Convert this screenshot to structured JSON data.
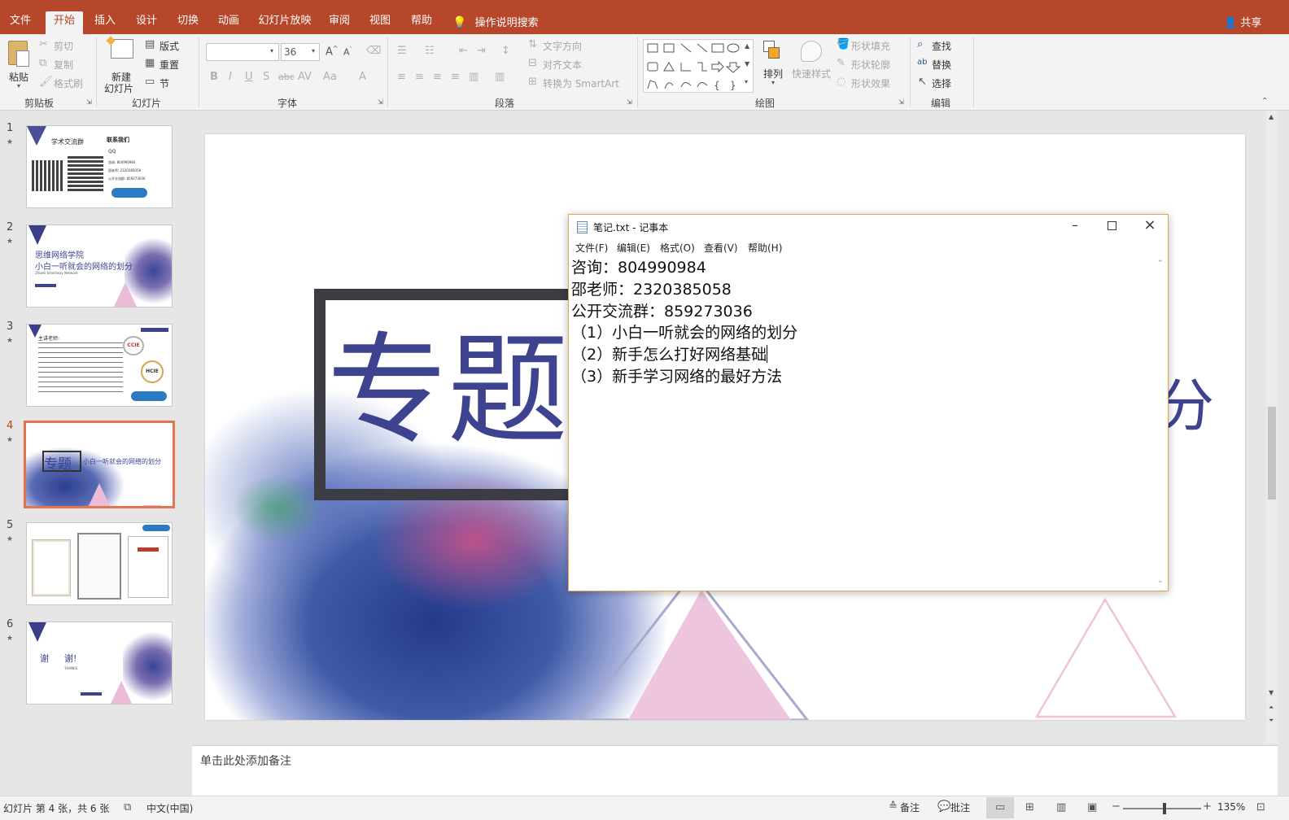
{
  "ribbon_tabs": [
    "文件",
    "开始",
    "插入",
    "设计",
    "切换",
    "动画",
    "幻灯片放映",
    "审阅",
    "视图",
    "帮助"
  ],
  "active_tab": "开始",
  "tell_me": "操作说明搜索",
  "share": "共享",
  "ribbon": {
    "clipboard": {
      "paste": "粘贴",
      "cut": "剪切",
      "copy": "复制",
      "format_painter": "格式刷",
      "label": "剪贴板"
    },
    "slides": {
      "new_slide_line1": "新建",
      "new_slide_line2": "幻灯片",
      "layout": "版式",
      "reset": "重置",
      "section": "节",
      "label": "幻灯片"
    },
    "font": {
      "size": "36",
      "label": "字体",
      "buttons": [
        "B",
        "I",
        "U",
        "S",
        "abc",
        "AV",
        "Aa",
        "A"
      ]
    },
    "paragraph": {
      "text_direction": "文字方向",
      "align_text": "对齐文本",
      "convert_smartart": "转换为 SmartArt",
      "label": "段落"
    },
    "drawing": {
      "arrange": "排列",
      "quick_styles": "快速样式",
      "shape_fill": "形状填充",
      "shape_outline": "形状轮廓",
      "shape_effects": "形状效果",
      "label": "绘图"
    },
    "editing": {
      "find": "查找",
      "replace": "替换",
      "select": "选择",
      "label": "编辑"
    }
  },
  "thumbnails": [
    {
      "num": "1",
      "title": "学术交流群",
      "heading": "联系我们",
      "qq": "QQ",
      "lines": [
        "咨询: 804990984",
        "邵老师: 2320385058",
        "公开交流群: 859273036"
      ]
    },
    {
      "num": "2",
      "line1": "思维网络学院",
      "line2": "小白一听就会的网络的划分",
      "line3": "Zhiwei Smartway Network"
    },
    {
      "num": "3",
      "title": "主讲老师:",
      "badge1": "CCIE",
      "badge2": "HCIE"
    },
    {
      "num": "4",
      "tag": "专题",
      "title": "小白一听就会的网络的划分"
    },
    {
      "num": "5"
    },
    {
      "num": "6",
      "text1": "谢",
      "text2": "谢!",
      "text3": "THANKS"
    }
  ],
  "selected_slide": "4",
  "slide": {
    "title_part1": "专题",
    "title_part2": "分"
  },
  "notepad": {
    "title": "笔记.txt - 记事本",
    "menu": [
      "文件(F)",
      "编辑(E)",
      "格式(O)",
      "查看(V)",
      "帮助(H)"
    ],
    "lines": [
      "咨询：804990984",
      "邵老师：2320385058",
      "公开交流群：859273036",
      "",
      "（1）小白一听就会的网络的划分",
      "",
      "（2）新手怎么打好网络基础",
      "",
      "（3）新手学习网络的最好方法"
    ]
  },
  "notes_placeholder": "单击此处添加备注",
  "status": {
    "slide_info": "幻灯片 第 4 张，共 6 张",
    "language": "中文(中国)",
    "notes": "备注",
    "comments": "批注",
    "zoom": "135%"
  }
}
